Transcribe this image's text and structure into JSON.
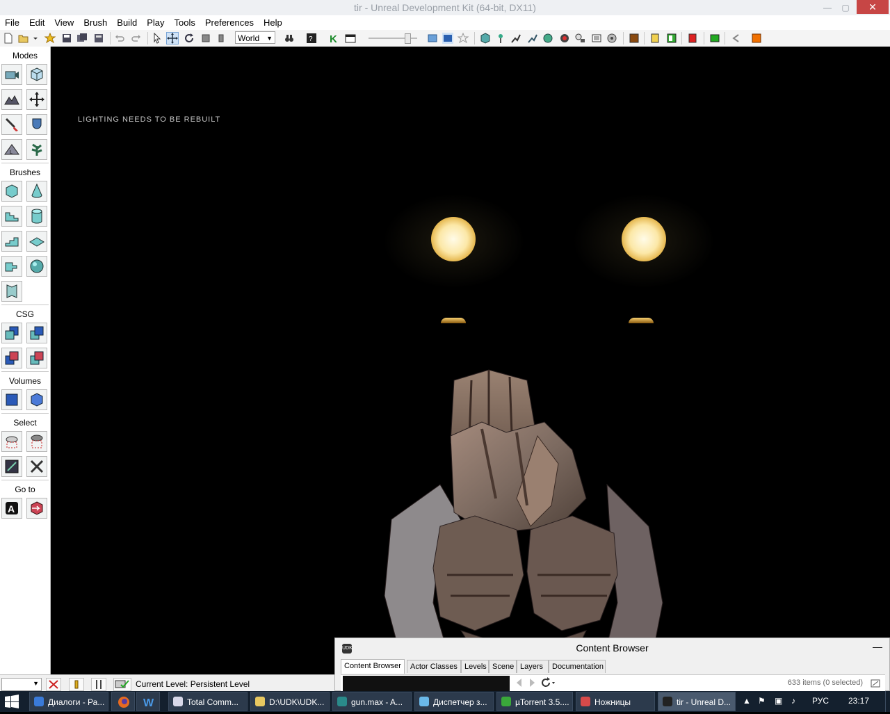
{
  "window": {
    "title": "tir - Unreal Development Kit (64-bit, DX11)",
    "minimize_glyph": "—",
    "maximize_glyph": "▢",
    "close_glyph": "✕"
  },
  "menu": [
    "File",
    "Edit",
    "View",
    "Brush",
    "Build",
    "Play",
    "Tools",
    "Preferences",
    "Help"
  ],
  "toolbar": {
    "coordinate_system": "World"
  },
  "left_panel": {
    "sections": {
      "modes": "Modes",
      "brushes": "Brushes",
      "csg": "CSG",
      "volumes": "Volumes",
      "select": "Select",
      "goto": "Go to"
    },
    "goto_letter": "A"
  },
  "viewport": {
    "warning": "LIGHTING NEEDS TO BE REBUILT"
  },
  "status_bar": {
    "current_level": "Current Level:  Persistent Level"
  },
  "content_browser": {
    "title": "Content Browser",
    "logo": "UDK",
    "minimize_glyph": "—",
    "tabs": [
      "Content Browser",
      "Actor Classes",
      "Levels",
      "Scene",
      "Layers",
      "Documentation"
    ],
    "active_tab": "Content Browser",
    "item_count": "633 items (0 selected)"
  },
  "taskbar": {
    "items": [
      {
        "label": "Диалоги - Ра..."
      },
      {
        "label": "Total Comm..."
      },
      {
        "label": "D:\\UDK\\UDK..."
      },
      {
        "label": "gun.max - A..."
      },
      {
        "label": "Диспетчер з..."
      },
      {
        "label": "µTorrent 3.5...."
      },
      {
        "label": "Ножницы"
      },
      {
        "label": "tir - Unreal D..."
      }
    ],
    "language": "РУС",
    "time": "23:17",
    "colors": {
      "background": "#14202e",
      "button": "#2c3a4c",
      "active_button": "#4a5a6e"
    }
  },
  "colors": {
    "close_button": "#c74645",
    "viewport_background": "#000000",
    "light_glow": "#fff4c8",
    "gun_metal": "#7c6a60"
  }
}
